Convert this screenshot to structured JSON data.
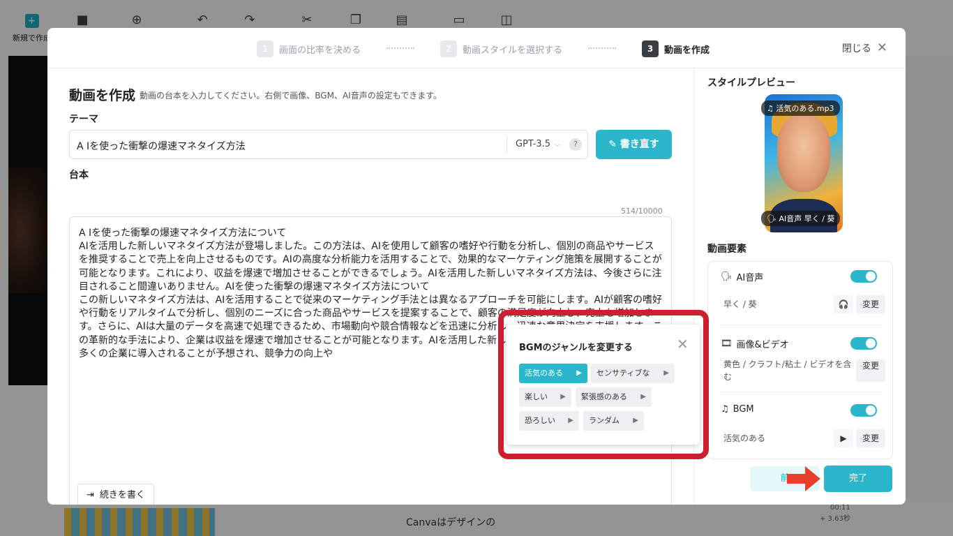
{
  "background": {
    "new_label": "新規で作成",
    "canva_text": "Canvaはデザインの",
    "time1": "00:11",
    "time2": "+ 3.63秒"
  },
  "steps": [
    {
      "num": "1",
      "label": "画面の比率を決める"
    },
    {
      "num": "2",
      "label": "動画スタイルを選択する"
    },
    {
      "num": "3",
      "label": "動画を作成"
    }
  ],
  "close_label": "閉じる",
  "main": {
    "title": "動画を作成",
    "subtitle": "動画の台本を入力してください。右側で画像、BGM、AI音声の設定もできます。",
    "theme_label": "テーマ",
    "theme_value": "A Iを使った衝撃の爆速マネタイズ方法",
    "model": "GPT-3.5",
    "rewrite_label": "書き直す",
    "script_label": "台本",
    "counter": "514/10000",
    "script_text": "A Iを使った衝撃の爆速マネタイズ方法について\nAIを活用した新しいマネタイズ方法が登場しました。この方法は、AIを使用して顧客の嗜好や行動を分析し、個別の商品やサービスを推奨することで売上を向上させるものです。AIの高度な分析能力を活用することで、効果的なマーケティング施策を展開することが可能となります。これにより、収益を爆速で増加させることができるでしょう。AIを活用した新しいマネタイズ方法は、今後さらに注目されること間違いありません。AIを使った衝撃の爆速マネタイズ方法について\nこの新しいマネタイズ方法は、AIを活用することで従来のマーケティング手法とは異なるアプローチを可能にします。AIが顧客の嗜好や行動をリアルタイムで分析し、個別のニーズに合った商品やサービスを提案することで、顧客の満足度が向上し、売上も増加します。さらに、AIは大量のデータを高速で処理できるため、市場動向や競合情報などを迅速に分析し、迅速な意思決定を支援します。この革新的な手法により、企業は収益を爆速で増加させることが可能となります。AIを活用した新しいマネタイズ方法は、今後ますます多くの企業に導入されることが予想され、競争力の向上や",
    "continue_label": "続きを書く"
  },
  "right": {
    "preview_title": "スタイルプレビュー",
    "music_pill": "活気のある.mp3",
    "voice_pill": "AI音声  早く / 葵",
    "elements_title": "動画要素",
    "ai_voice": {
      "label": "AI音声",
      "value": "早く / 葵",
      "change": "変更"
    },
    "media": {
      "label": "画像&ビデオ",
      "value": "黄色 / クラフト/粘土 / ビデオを含む",
      "change": "変更"
    },
    "bgm": {
      "label": "BGM",
      "value": "活気のある",
      "change": "変更"
    },
    "prev_label": "前",
    "done_label": "完了"
  },
  "popup": {
    "title": "BGMのジャンルを変更する",
    "genres": [
      "活気のある",
      "センサティブな",
      "楽しい",
      "緊張感のある",
      "恐ろしい",
      "ランダム"
    ],
    "selected": "活気のある"
  },
  "colors": {
    "accent": "#2cb6cc",
    "highlight": "#cf1f2f",
    "arrow": "#e8402c"
  }
}
